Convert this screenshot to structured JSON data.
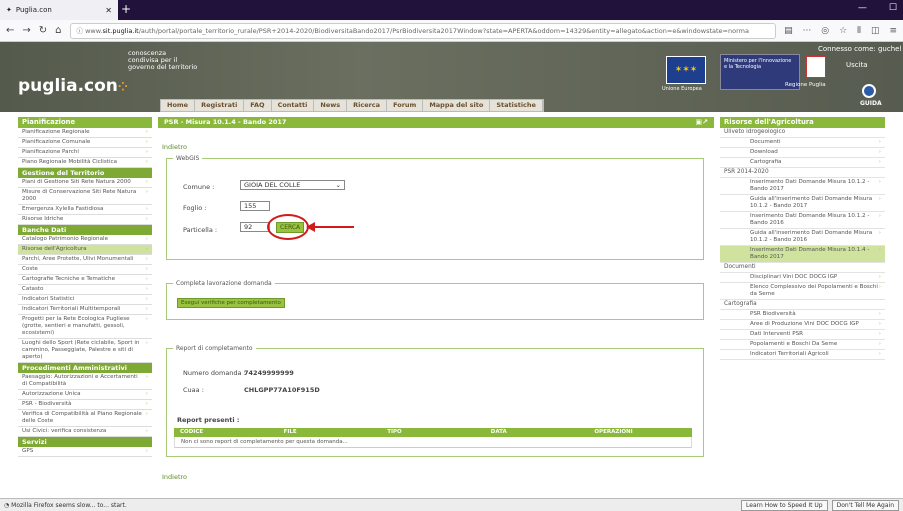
{
  "browser": {
    "tab_title": "Puglia.con",
    "url_pre": "www.",
    "url_domain": "sit.puglia.it",
    "url_path": "/auth/portal/portale_territorio_rurale/PSR+2014-2020/BiodiversitaBando2017/PsrBiodiversita2017Window?state=APERTA&oddom=14329&entity=allegato&action=e&windowstate=norma"
  },
  "header": {
    "logo": "puglia.con",
    "tagline": "conoscenza condivisa per il governo del territorio",
    "eu_label": "Unione Europea",
    "min_text": "Ministero per l'Innovazione e la Tecnologia",
    "reg_label": "Regione Puglia",
    "connected": "Connesso come: guchel",
    "logout": "Uscita",
    "guide": "GUIDA"
  },
  "menu": [
    "Home",
    "Registrati",
    "FAQ",
    "Contatti",
    "News",
    "Ricerca",
    "Forum",
    "Mappa del sito",
    "Statistiche"
  ],
  "left": {
    "sections": [
      {
        "title": "Pianificazione",
        "items": [
          "Pianificazione Regionale",
          "Pianificazione Comunale",
          "Pianificazione Parchi",
          "Piano Regionale Mobilità Ciclistica"
        ]
      },
      {
        "title": "Gestione del Territorio",
        "items": [
          "Piani di Gestione Siti Rete Natura 2000",
          "Misure di Conservazione Siti Rete Natura 2000",
          "Emergenza Xylella Fastidiosa",
          "Risorse Idriche"
        ]
      },
      {
        "title": "Banche Dati",
        "items": [
          "Catalogo Patrimonio Regionale",
          "Risorse dell'Agricoltura",
          "Parchi, Aree Protette, Ulivi Monumentali",
          "Coste",
          "Cartografie Tecniche e Tematiche",
          "Catasto",
          "Indicatori Statistici",
          "Indicatori Territoriali Multitemporali",
          "Progetti per la Rete Ecologica Pugliese (grotte, sentieri e manufatti, gessoli, ecosistemi)",
          "Luoghi dello Sport (Rete ciclabile, Sport in cammino, Passeggiate, Palestre e siti di aperto)"
        ]
      },
      {
        "title": "Procedimenti Amministrativi",
        "items": [
          "Paesaggio: Autorizzazioni e Accertamenti di Compatibilità",
          "Autorizzazione Unica",
          "PSR - Biodiversità",
          "Verifica di Compatibilità al Piano Regionale delle Coste",
          "Usi Civici: verifica consistenza"
        ]
      },
      {
        "title": "Servizi",
        "items": [
          "GPS"
        ]
      }
    ]
  },
  "main": {
    "title": "PSR - Misura 10.1.4 - Bando 2017",
    "back": "Indietro",
    "webgis_legend": "WebGIS",
    "comune_label": "Comune :",
    "comune_value": "GIOIA DEL COLLE",
    "foglio_label": "Foglio :",
    "foglio_value": "155",
    "particella_label": "Particella :",
    "particella_value": "92",
    "cerca": "CERCA",
    "completa_legend": "Completa lavorazione domanda",
    "verifica": "Esegui verifiche per completamento",
    "report_legend": "Report di completamento",
    "numero_label": "Numero domanda :",
    "numero_value": "74249999999",
    "cuaa_label": "Cuaa :",
    "cuaa_value": "CHLGPP77A10F915D",
    "report_presenti": "Report presenti :",
    "table_headers": [
      "CODICE",
      "FILE",
      "TIPO",
      "DATA",
      "OPERAZIONI"
    ],
    "table_empty": "Non ci sono report di completamento per questa domanda...",
    "back2": "Indietro"
  },
  "right": {
    "title": "Risorse dell'Agricoltura",
    "groups": [
      {
        "name": "Uliveto idrogeologico",
        "items": [
          "Documenti",
          "Download",
          "Cartografia"
        ]
      },
      {
        "name": "PSR 2014-2020",
        "items": [
          "Inserimento Dati Domande Misura 10.1.2 - Bando 2017",
          "Guida all'inserimento Dati Domande Misura 10.1.2 - Bando 2017",
          "Inserimento Dati Domande Misura 10.1.2 - Bando 2016",
          "Guida all'inserimento Dati Domande Misura 10.1.2 - Bando 2016",
          "Inserimento Dati Domande Misura 10.1.4 - Bando 2017"
        ]
      },
      {
        "name": "Documenti",
        "items": [
          "Disciplinari Vini DOC DOCG IGP",
          "Elenco Complessivo dei Popolamenti e Boschi da Seme"
        ]
      },
      {
        "name": "Cartografia",
        "items": [
          "PSR Biodiversità",
          "Aree di Produzione Vini DOC DOCG IGP",
          "Dati Interventi PSR",
          "Popolamenti e Boschi Da Seme",
          "Indicatori Territoriali Agricoli"
        ]
      }
    ]
  },
  "status": {
    "text": "Mozilla Firefox seems slow... to... start.",
    "btn1": "Learn How to Speed It Up",
    "btn2": "Don't Tell Me Again"
  }
}
